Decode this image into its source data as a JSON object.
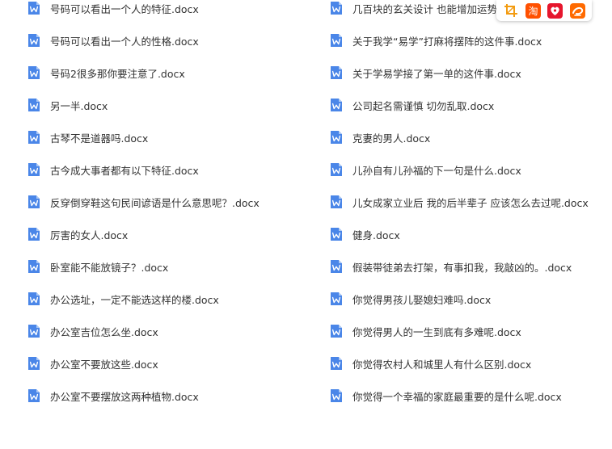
{
  "files_left": [
    "号码可以看出一个人的特征.docx",
    "号码可以看出一个人的性格.docx",
    "号码2很多那你要注意了.docx",
    "另一半.docx",
    "古琴不是道器吗.docx",
    "古今成大事者都有以下特征.docx",
    "反穿倒穿鞋这句民间谚语是什么意思呢？.docx",
    "厉害的女人.docx",
    "卧室能不能放镜子？.docx",
    "办公选址，一定不能选这样的楼.docx",
    "办公室吉位怎么坐.docx",
    "办公室不要放这些.docx",
    "办公室不要摆放这两种植物.docx"
  ],
  "files_right": [
    "几百块的玄关设计 也能增加运势喔",
    "关于我学“易学”打麻将摆阵的这件事.docx",
    "关于学易学接了第一单的这件事.docx",
    "公司起名需谨慎 切勿乱取.docx",
    "克妻的男人.docx",
    "儿孙自有儿孙福的下一句是什么.docx",
    "儿女成家立业后 我的后半辈子 应该怎么去过呢.docx",
    "健身.docx",
    "假装带徒弟去打架，有事扣我，我敲凶的。.docx",
    "你觉得男孩儿娶媳妇难吗.docx",
    "你觉得男人的一生到底有多难呢.docx",
    "你觉得农村人和城里人有什么区别.docx",
    "你觉得一个幸福的家庭最重要的是什么呢.docx"
  ],
  "toolbar": {
    "tools": [
      "crop-icon",
      "taobao-icon",
      "weibo-icon",
      "alibaba-icon"
    ],
    "taobao_label": "淘"
  },
  "colors": {
    "doc_icon": "#4a86e8",
    "text": "#333333",
    "crop": "#f39c12",
    "taobao": "#ff5000",
    "weibo": "#e6162d",
    "alibaba": "#ff6a00"
  }
}
